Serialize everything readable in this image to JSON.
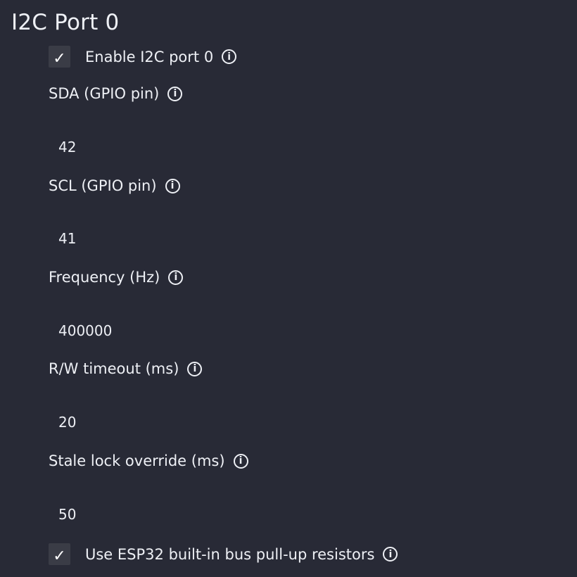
{
  "section": {
    "title": "I2C Port 0"
  },
  "enable": {
    "label": "Enable I2C port 0",
    "checked": true,
    "check_glyph": "✓"
  },
  "fields": [
    {
      "label": "SDA (GPIO pin)",
      "value": "42"
    },
    {
      "label": "SCL (GPIO pin)",
      "value": "41"
    },
    {
      "label": "Frequency (Hz)",
      "value": "400000"
    },
    {
      "label": "R/W timeout (ms)",
      "value": "20"
    },
    {
      "label": "Stale lock override (ms)",
      "value": "50"
    }
  ],
  "pullup": {
    "label": "Use ESP32 built-in bus pull-up resistors",
    "checked": true,
    "check_glyph": "✓"
  },
  "info_glyph": "i",
  "colors": {
    "background": "#282a36",
    "text": "#eef0f5",
    "checkbox_bg": "#3a3c46"
  }
}
